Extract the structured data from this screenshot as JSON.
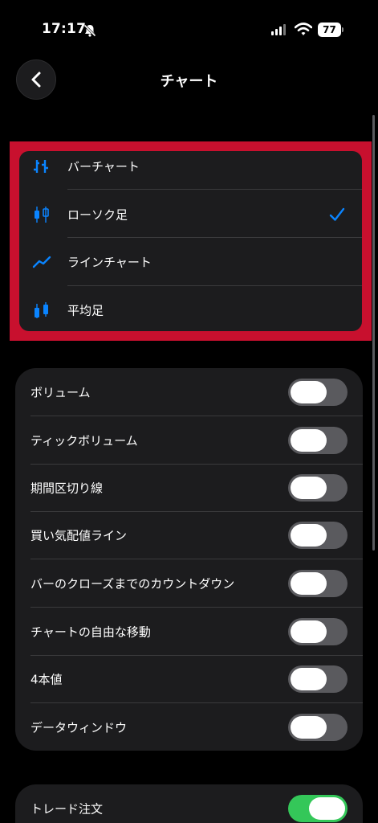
{
  "status_bar": {
    "time": "17:17",
    "battery": "77",
    "icons": [
      "bell-slash-icon",
      "cellular-signal-icon",
      "wifi-icon",
      "battery-icon"
    ]
  },
  "nav": {
    "title": "チャート",
    "back_icon": "chevron-left-icon"
  },
  "chart_types": [
    {
      "label": "バーチャート",
      "icon": "bar-chart-icon",
      "selected": false
    },
    {
      "label": "ローソク足",
      "icon": "candlestick-icon",
      "selected": true
    },
    {
      "label": "ラインチャート",
      "icon": "line-chart-icon",
      "selected": false
    },
    {
      "label": "平均足",
      "icon": "heikin-ashi-icon",
      "selected": false
    }
  ],
  "display_settings": [
    {
      "label": "ボリューム",
      "on": false
    },
    {
      "label": "ティックボリューム",
      "on": false
    },
    {
      "label": "期間区切り線",
      "on": false
    },
    {
      "label": "買い気配値ライン",
      "on": false
    },
    {
      "label": "バーのクローズまでのカウントダウン",
      "on": false
    },
    {
      "label": "チャートの自由な移動",
      "on": false
    },
    {
      "label": "4本値",
      "on": false
    },
    {
      "label": "データウィンドウ",
      "on": false
    }
  ],
  "trade_settings": [
    {
      "label": "トレード注文",
      "on": true
    }
  ],
  "colors": {
    "background": "#000000",
    "card": "#1c1c1e",
    "accent_blue": "#0a84ff",
    "toggle_on": "#34c759",
    "toggle_off": "#5a5a5e",
    "highlight_frame": "#c8102e"
  }
}
